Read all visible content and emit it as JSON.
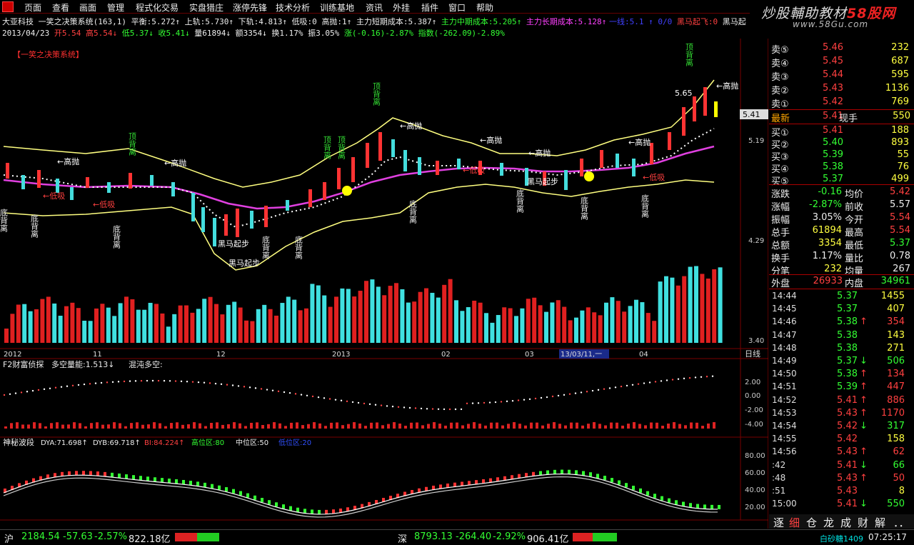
{
  "menu": [
    "页面",
    "查看",
    "画面",
    "管理",
    "程式化交易",
    "实盘猎庄",
    "涨停先锋",
    "技术分析",
    "训练基地",
    "资讯",
    "外挂",
    "插件",
    "窗口",
    "帮助"
  ],
  "brand": {
    "text_a": "炒股輔助教材",
    "text_b": "58股网",
    "url": "www.58Gu.com"
  },
  "info1": {
    "stock": "大亚科技",
    "formula": "一笑之决策系统(163,1)",
    "pinghen": "平衡:5.272↑",
    "shangui": "上轨:5.730↑",
    "xiagui": "下轨:4.813↑",
    "dixi": "低吸:0",
    "gaopao": "高抛:1↑",
    "zl_short": "主力短期成本:5.387↑",
    "zl_mid": "主力中期成本:5.205↑",
    "zl_long": "主力长期成本:5.128↑",
    "yixi": "一线:5.1 ↑ 0/0",
    "heima": "黑马起飞:0",
    "heima2": "黑马起"
  },
  "info2": {
    "date": "2013/04/23",
    "open": "开5.54",
    "high": "高5.54↓",
    "low": "低5.37↓",
    "close": "收5.41↓",
    "vol": "量61894↓",
    "amt": "额3354↓",
    "turn": "换1.17%",
    "amp": "振3.05%",
    "chg": "涨(-0.16)-2.87%",
    "idx": "指数(-262.09)-2.89%"
  },
  "chart": {
    "system_label": "【一笑之决策系统】",
    "price_ticks": [
      "5.41",
      "5.19",
      "4.29",
      "3.40"
    ],
    "current_price": "5.41",
    "high_mark": "5.65",
    "annotations": {
      "gaopao": "←高抛",
      "dixi": "←低吸",
      "dingbeili": "顶背离",
      "dibeili": "底背离",
      "heima": "黑马起步"
    },
    "date_axis": [
      "2012",
      "11",
      "12",
      "2013",
      "02",
      "03",
      "13/03/11,一",
      "04"
    ],
    "period": "日线",
    "panel2_title": "F2财富侦探",
    "panel2_a": "多空量能:1.513↓",
    "panel2_b": "混沌多空:",
    "panel2_ticks": [
      "2.00",
      "0.00",
      "-2.00",
      "-4.00"
    ],
    "panel3_title": "神秘波段",
    "panel3_dya": "DYA:71.698↑",
    "panel3_dyb": "DYB:69.718↑",
    "panel3_bi": "BI:84.224↑",
    "panel3_hi": "高位区:80",
    "panel3_mid": "中位区:50",
    "panel3_lo": "低位区:20",
    "panel3_ticks": [
      "80.00",
      "60.00",
      "40.00",
      "20.00"
    ]
  },
  "quote": {
    "sell": [
      {
        "label": "卖⑤",
        "price": "5.46",
        "vol": "232"
      },
      {
        "label": "卖④",
        "price": "5.45",
        "vol": "687"
      },
      {
        "label": "卖③",
        "price": "5.44",
        "vol": "595"
      },
      {
        "label": "卖②",
        "price": "5.43",
        "vol": "1136"
      },
      {
        "label": "卖①",
        "price": "5.42",
        "vol": "769"
      }
    ],
    "latest": {
      "label": "最新",
      "price": "5.41",
      "k2": "现手",
      "v2": "550"
    },
    "buy": [
      {
        "label": "买①",
        "price": "5.41",
        "vol": "188"
      },
      {
        "label": "买②",
        "price": "5.40",
        "vol": "893"
      },
      {
        "label": "买③",
        "price": "5.39",
        "vol": "55"
      },
      {
        "label": "买④",
        "price": "5.38",
        "vol": "76"
      },
      {
        "label": "买⑤",
        "price": "5.37",
        "vol": "499"
      }
    ],
    "stats": [
      {
        "k1": "涨跌",
        "v1": "-0.16",
        "k2": "均价",
        "v2": "5.42"
      },
      {
        "k1": "涨幅",
        "v1": "-2.87%",
        "k2": "前收",
        "v2": "5.57"
      },
      {
        "k1": "振幅",
        "v1": "3.05%",
        "k2": "今开",
        "v2": "5.54"
      },
      {
        "k1": "总手",
        "v1": "61894",
        "k2": "最高",
        "v2": "5.54"
      },
      {
        "k1": "总额",
        "v1": "3354",
        "k2": "最低",
        "v2": "5.37"
      },
      {
        "k1": "换手",
        "v1": "1.17%",
        "k2": "量比",
        "v2": "0.78"
      },
      {
        "k1": "分笔",
        "v1": "232",
        "k2": "均量",
        "v2": "267"
      }
    ],
    "waipan": {
      "k1": "外盘",
      "v1": "26933",
      "k2": "内盘",
      "v2": "34961"
    },
    "ticks": [
      {
        "t": "14:44",
        "p": "5.37",
        "a": "",
        "v": "1455"
      },
      {
        "t": "14:45",
        "p": "5.37",
        "a": "",
        "v": "407"
      },
      {
        "t": "14:46",
        "p": "5.38",
        "a": "↑",
        "v": "354"
      },
      {
        "t": "14:47",
        "p": "5.38",
        "a": "",
        "v": "143"
      },
      {
        "t": "14:48",
        "p": "5.38",
        "a": "",
        "v": "271"
      },
      {
        "t": "14:49",
        "p": "5.37",
        "a": "↓",
        "v": "506"
      },
      {
        "t": "14:50",
        "p": "5.38",
        "a": "↑",
        "v": "134"
      },
      {
        "t": "14:51",
        "p": "5.39",
        "a": "↑",
        "v": "447"
      },
      {
        "t": "14:52",
        "p": "5.41",
        "a": "↑",
        "v": "886"
      },
      {
        "t": "14:53",
        "p": "5.43",
        "a": "↑",
        "v": "1170"
      },
      {
        "t": "14:54",
        "p": "5.42",
        "a": "↓",
        "v": "317"
      },
      {
        "t": "14:55",
        "p": "5.42",
        "a": "",
        "v": "158"
      },
      {
        "t": "14:56",
        "p": "5.43",
        "a": "↑",
        "v": "62"
      },
      {
        "t": ":42",
        "p": "5.41",
        "a": "↓",
        "v": "66"
      },
      {
        "t": ":48",
        "p": "5.43",
        "a": "↑",
        "v": "50"
      },
      {
        "t": ":51",
        "p": "5.43",
        "a": "",
        "v": "8"
      },
      {
        "t": "15:00",
        "p": "5.41",
        "a": "↓",
        "v": "550"
      }
    ],
    "tabs": [
      "逐",
      "细",
      "仓",
      "龙",
      "成",
      "财",
      "解",
      "．．"
    ]
  },
  "status": {
    "sh_label": "沪",
    "sh_val": "2184.54",
    "sh_chg": "-57.63",
    "sh_pct": "-2.57%",
    "sh_amt": "822.18亿",
    "sz_label": "深",
    "sz_val": "8793.13",
    "sz_chg": "-264.40",
    "sz_pct": "-2.92%",
    "sz_amt": "906.41亿",
    "ticker": "白砂糖1409",
    "time": "07:25:17"
  }
}
